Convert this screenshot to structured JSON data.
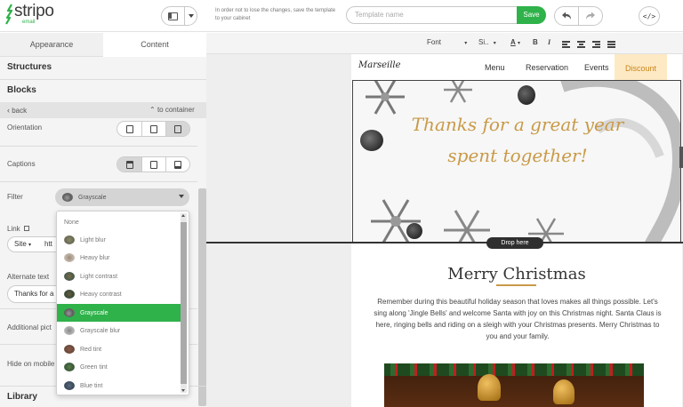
{
  "app": {
    "logo": "stripo",
    "logo_sub": "email",
    "brand_color": "#2fb24a"
  },
  "header": {
    "notice": "In order not to lose the changes, save the template to your cabinet",
    "template_name_placeholder": "Template name",
    "save_label": "Save",
    "icons": [
      "layout-icon",
      "chevron-down-icon",
      "undo-icon",
      "redo-icon",
      "code-icon"
    ]
  },
  "left_panel": {
    "tabs": [
      {
        "label": "Appearance",
        "active": false
      },
      {
        "label": "Content",
        "active": true
      }
    ],
    "structures_label": "Structures",
    "blocks_label": "Blocks",
    "back_label": "back",
    "to_container_label": "to container",
    "orientation_label": "Orientation",
    "captions_label": "Captions",
    "filter_label": "Filter",
    "filter_value": "Grayscale",
    "link_label": "Link",
    "link_type": "Site",
    "link_value_partial": "htt",
    "alt_text_label": "Alternate text",
    "alt_text_value_partial": "Thanks for a",
    "additional_pic_label": "Additional pict",
    "hide_on_mobile_label": "Hide on mobile",
    "library_label": "Library"
  },
  "filter_dropdown": {
    "selected": "Grayscale",
    "options": [
      {
        "label": "None",
        "thumb": "none"
      },
      {
        "label": "Light blur",
        "thumb": "blur"
      },
      {
        "label": "Heavy blur",
        "thumb": "heavy-blur"
      },
      {
        "label": "Light contrast",
        "thumb": "contrast"
      },
      {
        "label": "Heavy contrast",
        "thumb": "heavy-contrast"
      },
      {
        "label": "Grayscale",
        "thumb": "grayscale"
      },
      {
        "label": "Grayscale blur",
        "thumb": "grayscale-blur"
      },
      {
        "label": "Red tint",
        "thumb": "red"
      },
      {
        "label": "Green tint",
        "thumb": "green"
      },
      {
        "label": "Blue tint",
        "thumb": "blue"
      }
    ]
  },
  "format_toolbar": {
    "font_label": "Font",
    "size_label": "Si..",
    "icons": [
      "text-color-icon",
      "bold-icon",
      "italic-icon",
      "align-left-icon",
      "align-center-icon",
      "align-right-icon",
      "align-justify-icon"
    ]
  },
  "email": {
    "brand": "Marseille",
    "nav": [
      "Menu",
      "Reservation",
      "Events"
    ],
    "discount_label": "Discount",
    "hero_line1": "Thanks for a great year",
    "hero_line2": "spent together!",
    "drop_here": "Drop here",
    "heading": "Merry Christmas",
    "body": "Remember during this beautiful holiday season that loves makes all things possible. Let's sing along 'Jingle Bells' and welcome Santa with joy on this Christmas night. Santa Claus is here, ringing bells and riding on a sleigh with your Christmas presents. Merry Christmas to you and your family."
  }
}
